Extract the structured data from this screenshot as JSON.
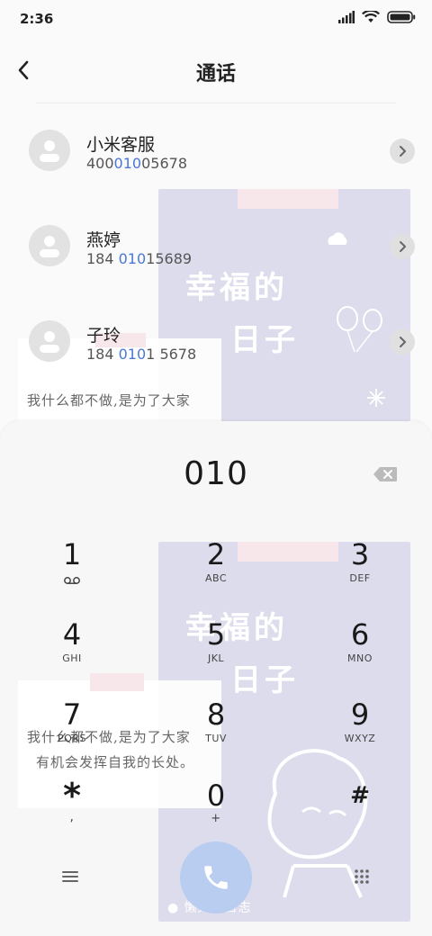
{
  "status_bar": {
    "time": "2:36"
  },
  "header": {
    "title": "通话"
  },
  "contacts": [
    {
      "name": "小米客服",
      "number_pre": "400",
      "number_match": "010",
      "number_post": "05678"
    },
    {
      "name": "燕婷",
      "number_pre": "184 ",
      "number_match": "010",
      "number_post": "15689"
    },
    {
      "name": "子玲",
      "number_pre": "184 ",
      "number_match": "010",
      "number_post": "1 5678"
    }
  ],
  "wallpaper": {
    "headline_1": "幸福的",
    "headline_2": "日子",
    "note_line_1": "我什么都不做,是为了大家",
    "note_line_2": "有机会发挥自我的长处。",
    "footer_text": "● 懒人的日志"
  },
  "dialer": {
    "input_value": "010",
    "keys": [
      {
        "digit": "1",
        "letters": ""
      },
      {
        "digit": "2",
        "letters": "ABC"
      },
      {
        "digit": "3",
        "letters": "DEF"
      },
      {
        "digit": "4",
        "letters": "GHI"
      },
      {
        "digit": "5",
        "letters": "JKL"
      },
      {
        "digit": "6",
        "letters": "MNO"
      },
      {
        "digit": "7",
        "letters": "PQRS"
      },
      {
        "digit": "8",
        "letters": "TUV"
      },
      {
        "digit": "9",
        "letters": "WXYZ"
      },
      {
        "digit": "*",
        "letters": ","
      },
      {
        "digit": "0",
        "letters": "+"
      },
      {
        "digit": "#",
        "letters": ""
      }
    ]
  },
  "icons": {
    "back": "chevron-left-icon",
    "backspace": "backspace-icon",
    "call": "phone-icon",
    "menu": "menu-icon",
    "keypad": "keypad-grid-icon",
    "voicemail": "voicemail-icon",
    "detail": "chevron-right-icon"
  },
  "colors": {
    "accent": "#4a78d8",
    "call_button": "#b8cdef",
    "wallpaper": "#dcdcec"
  }
}
